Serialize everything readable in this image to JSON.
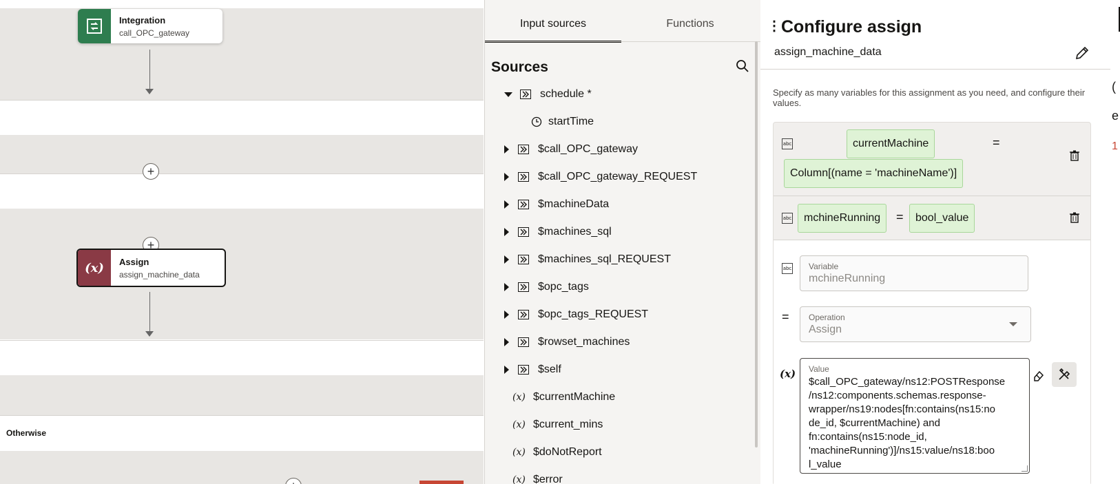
{
  "canvas": {
    "integration_node": {
      "title": "Integration",
      "subtitle": "call_OPC_gateway"
    },
    "assign_node": {
      "title": "Assign",
      "subtitle": "assign_machine_data",
      "icon": "(x)"
    },
    "otherwise_label": "Otherwise",
    "plus": "+"
  },
  "sources_panel": {
    "tabs": [
      {
        "label": "Input sources",
        "active": true
      },
      {
        "label": "Functions",
        "active": false
      }
    ],
    "title": "Sources",
    "tree": [
      {
        "label": "schedule *",
        "kind": "group",
        "expanded": true
      },
      {
        "label": "startTime",
        "kind": "time"
      },
      {
        "label": "$call_OPC_gateway",
        "kind": "group"
      },
      {
        "label": "$call_OPC_gateway_REQUEST",
        "kind": "group"
      },
      {
        "label": "$machineData",
        "kind": "group"
      },
      {
        "label": "$machines_sql",
        "kind": "group"
      },
      {
        "label": "$machines_sql_REQUEST",
        "kind": "group"
      },
      {
        "label": "$opc_tags",
        "kind": "group"
      },
      {
        "label": "$opc_tags_REQUEST",
        "kind": "group"
      },
      {
        "label": "$rowset_machines",
        "kind": "group"
      },
      {
        "label": "$self",
        "kind": "group"
      },
      {
        "label": "$currentMachine",
        "kind": "var"
      },
      {
        "label": "$current_mins",
        "kind": "var"
      },
      {
        "label": "$doNotReport",
        "kind": "var"
      },
      {
        "label": "$error",
        "kind": "var"
      }
    ]
  },
  "config_panel": {
    "title": "Configure assign",
    "name": "assign_machine_data",
    "description": "Specify as many variables for this assignment as you need, and configure their values.",
    "assignments": [
      {
        "variable": "currentMachine",
        "value": "Column[(name = 'machineName')]"
      },
      {
        "variable": "mchineRunning",
        "value": "bool_value"
      }
    ],
    "equals": "=",
    "editor": {
      "variable_label": "Variable",
      "variable_value": "mchineRunning",
      "operation_label": "Operation",
      "operation_value": "Assign",
      "value_label": "Value",
      "value_lines": [
        "$call_OPC_gateway/ns12:POSTResponse",
        "/ns12:components.schemas.response-",
        "wrapper/ns19:nodes[fn:contains(ns15:no",
        "de_id, $currentMachine) and",
        "fn:contains(ns15:node_id,",
        "'machineRunning')]/ns15:value/ns18:boo",
        "l_value"
      ],
      "x_icon": "(x)"
    }
  },
  "right_edge": {
    "glyphs": [
      "(",
      "e",
      "1"
    ]
  },
  "colors": {
    "accent_green": "#2e7d4f",
    "assign_red": "#8a3a45",
    "chip_bg": "#dff3d6"
  }
}
